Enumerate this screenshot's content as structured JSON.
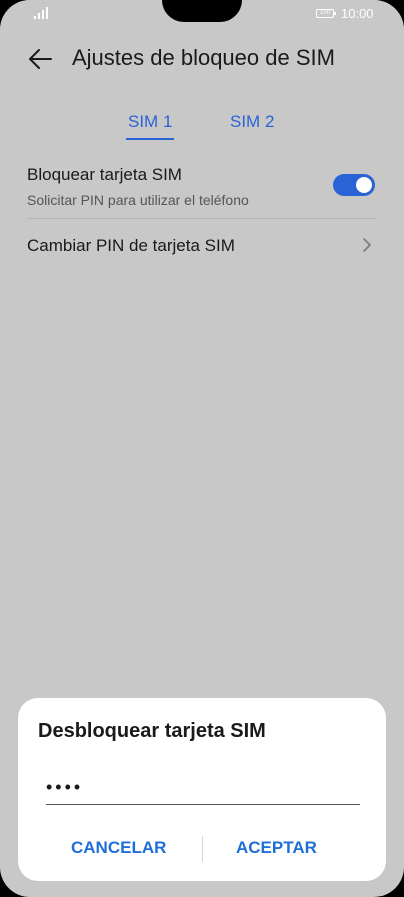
{
  "status_bar": {
    "battery": "100",
    "time": "10:00"
  },
  "header": {
    "title": "Ajustes de bloqueo de SIM"
  },
  "tabs": [
    {
      "label": "SIM 1",
      "selected": true
    },
    {
      "label": "SIM 2",
      "selected": false
    }
  ],
  "settings": {
    "lock_sim": {
      "title": "Bloquear tarjeta SIM",
      "subtitle": "Solicitar PIN para utilizar el teléfono",
      "enabled": true
    },
    "change_pin": {
      "title": "Cambiar PIN de tarjeta SIM"
    }
  },
  "dialog": {
    "title": "Desbloquear tarjeta SIM",
    "pin_value": "••••",
    "cancel_label": "CANCELAR",
    "accept_label": "ACEPTAR"
  },
  "colors": {
    "accent": "#2a63d6",
    "dialog_button": "#1f6fd8",
    "background": "#c8c8c8"
  },
  "icons": {
    "back": "arrow-left-icon",
    "chevron": "chevron-right-icon",
    "signal": "signal-icon",
    "battery": "battery-icon"
  }
}
